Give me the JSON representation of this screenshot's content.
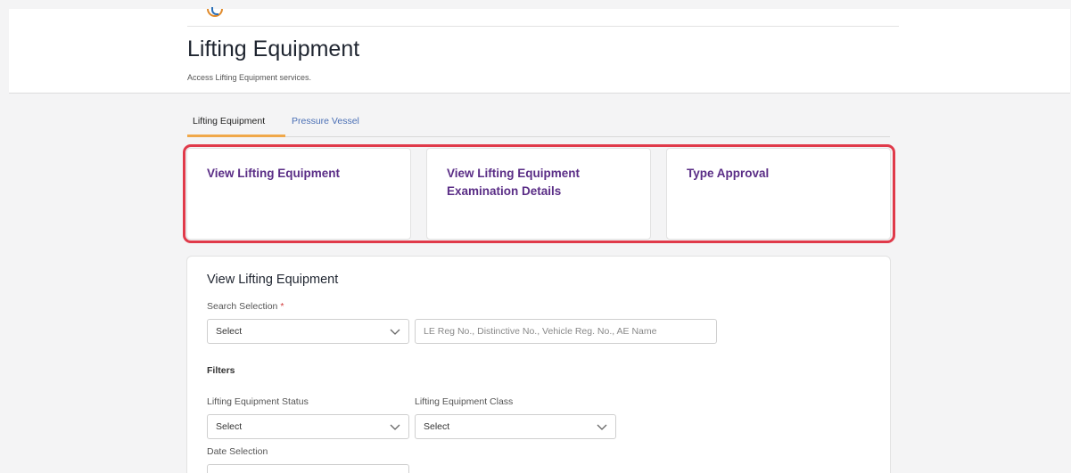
{
  "header": {
    "title": "Lifting Equipment",
    "subtitle": "Access Lifting Equipment services."
  },
  "tabs": [
    {
      "label": "Lifting Equipment",
      "active": true
    },
    {
      "label": "Pressure Vessel",
      "active": false
    }
  ],
  "cards": [
    {
      "label": "View Lifting Equipment"
    },
    {
      "label_line1": "View Lifting Equipment",
      "label_line2": "Examination Details"
    },
    {
      "label": "Type Approval"
    }
  ],
  "form": {
    "title": "View Lifting Equipment",
    "search_selection_label": "Search Selection",
    "required_mark": "*",
    "search_selection_value": "Select",
    "search_input_placeholder": "LE Reg No., Distinctive No., Vehicle Reg. No., AE Name",
    "filters_title": "Filters",
    "status_label": "Lifting Equipment Status",
    "status_value": "Select",
    "class_label": "Lifting Equipment Class",
    "class_value": "Select",
    "date_selection_label": "Date Selection"
  },
  "colors": {
    "accent_purple": "#5a2d86",
    "tab_underline": "#f0a84a",
    "highlight_red": "#e03a4a",
    "link_blue": "#4a6fb5"
  }
}
